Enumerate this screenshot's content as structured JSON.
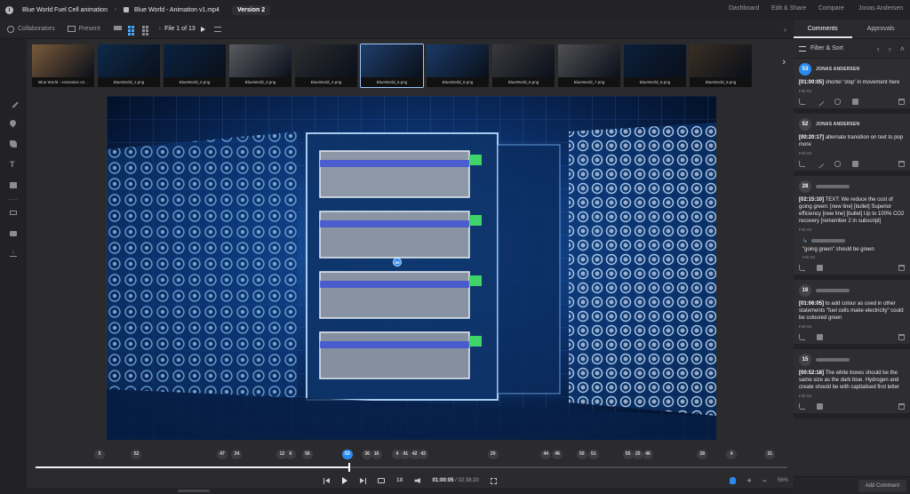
{
  "header": {
    "project": "Blue World Fuel Cell animation",
    "file": "Blue World - Animation v1.mp4",
    "version": "Version 2",
    "nav": [
      "Dashboard",
      "Edit & Share",
      "Compare",
      "Jonas Andersen"
    ]
  },
  "toolbar": {
    "collaborators": "Collaborators",
    "present": "Present",
    "file_counter": "File 1 of 13"
  },
  "thumbnails": [
    {
      "label": "Blue World - Animation v2...",
      "tone": "#7a5a3a"
    },
    {
      "label": "BlueWorld_1.png",
      "tone": "#0d2a4a"
    },
    {
      "label": "BlueWorld_2.png",
      "tone": "#0a2240"
    },
    {
      "label": "BlueWorld_3.png",
      "tone": "#5a5a60"
    },
    {
      "label": "BlueWorld_4.png",
      "tone": "#2b2d2f"
    },
    {
      "label": "BlueWorld_5.png",
      "tone": "#1f3e6a"
    },
    {
      "label": "BlueWorld_6.png",
      "tone": "#1a3a66"
    },
    {
      "label": "BlueWorld_6.png",
      "tone": "#3a3a3c"
    },
    {
      "label": "BlueWorld_7.png",
      "tone": "#505052"
    },
    {
      "label": "BlueWorld_8.png",
      "tone": "#0b1f3a"
    },
    {
      "label": "BlueWorld_9.png",
      "tone": "#3a2f22"
    }
  ],
  "viewer": {
    "marker": "53"
  },
  "timeline": {
    "markers": [
      {
        "label": "5",
        "pos": 0.095
      },
      {
        "label": "52",
        "pos": 0.143
      },
      {
        "label": "47",
        "pos": 0.255
      },
      {
        "label": "34",
        "pos": 0.274
      },
      {
        "label": "12",
        "pos": 0.333
      },
      {
        "label": "6",
        "pos": 0.344
      },
      {
        "label": "56",
        "pos": 0.366
      },
      {
        "label": "53",
        "pos": 0.418,
        "active": true
      },
      {
        "label": "36",
        "pos": 0.444
      },
      {
        "label": "16",
        "pos": 0.456
      },
      {
        "label": "4",
        "pos": 0.483
      },
      {
        "label": "41",
        "pos": 0.494
      },
      {
        "label": "42",
        "pos": 0.506
      },
      {
        "label": "43",
        "pos": 0.517
      },
      {
        "label": "20",
        "pos": 0.608
      },
      {
        "label": "44",
        "pos": 0.677
      },
      {
        "label": "46",
        "pos": 0.692
      },
      {
        "label": "50",
        "pos": 0.724
      },
      {
        "label": "51",
        "pos": 0.739
      },
      {
        "label": "55",
        "pos": 0.784
      },
      {
        "label": "25",
        "pos": 0.797
      },
      {
        "label": "46",
        "pos": 0.81
      },
      {
        "label": "28",
        "pos": 0.881
      },
      {
        "label": "4",
        "pos": 0.919
      },
      {
        "label": "31",
        "pos": 0.969
      }
    ],
    "progress": 0.417,
    "speed": "1X",
    "current_time": "01:00:05",
    "total_time": "02:38:20",
    "zoom": "56%"
  },
  "sidepanel": {
    "tabs": [
      "Comments",
      "Approvals"
    ],
    "filter_label": "Filter & Sort",
    "add_comment": "Add Comment",
    "comments": [
      {
        "num": "53",
        "author": "JONAS ANDERSEN",
        "time": "[01:00:05]",
        "text": "shorter 'stop' in movement here",
        "date": "Feb 03",
        "active": true,
        "actions": 5
      },
      {
        "num": "52",
        "author": "JONAS ANDERSEN",
        "time": "[00:20:17]",
        "text": "alternate transition on text to pop more",
        "date": "Feb 03",
        "actions": 5
      },
      {
        "num": "28",
        "author": "",
        "time": "[02:15:10]",
        "text": "TEXT: We reduce the cost of going green: [new line] [bullet] Superior efficiency [new line] [bullet] Up to 100% CO2 recovery [remember 2 in subscript]",
        "date": "Feb 03",
        "reply": {
          "text": "\"going green\" should be green",
          "date": "Feb 03"
        },
        "actions": 3
      },
      {
        "num": "16",
        "author": "",
        "time": "[01:06:05]",
        "text": "to add colour as used in other statements \"fuel cells make electricity\" could be coloured green",
        "date": "Feb 03",
        "actions": 3
      },
      {
        "num": "15",
        "author": "",
        "time": "[00:52:18]",
        "text": "The white boxes should be the same size as the dark blue. Hydrogen and create should be with capitalised first letter",
        "date": "Feb 03",
        "actions": 3
      }
    ]
  },
  "colors": {
    "accent": "#2a8cf2",
    "background": "#1b1b1e",
    "panel": "#2a2a2d"
  }
}
